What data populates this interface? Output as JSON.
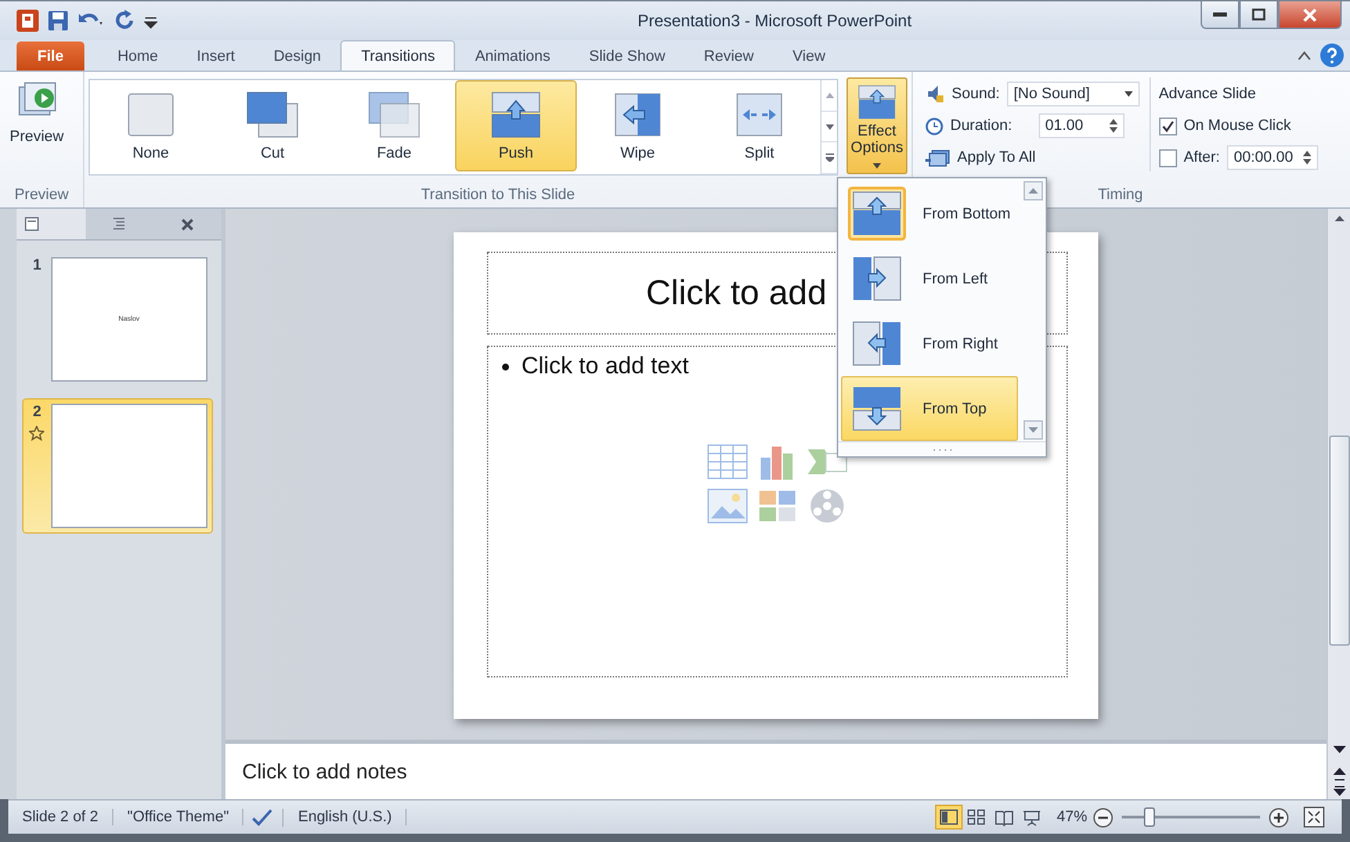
{
  "window": {
    "title": "Presentation3 - Microsoft PowerPoint"
  },
  "tabs": [
    {
      "label": "File",
      "kind": "file",
      "selected": false
    },
    {
      "label": "Home",
      "kind": "tab",
      "selected": false
    },
    {
      "label": "Insert",
      "kind": "tab",
      "selected": false
    },
    {
      "label": "Design",
      "kind": "tab",
      "selected": false
    },
    {
      "label": "Transitions",
      "kind": "tab",
      "selected": true
    },
    {
      "label": "Animations",
      "kind": "tab",
      "selected": false
    },
    {
      "label": "Slide Show",
      "kind": "tab",
      "selected": false
    },
    {
      "label": "Review",
      "kind": "tab",
      "selected": false
    },
    {
      "label": "View",
      "kind": "tab",
      "selected": false
    }
  ],
  "ribbon": {
    "preview_group": {
      "button": "Preview",
      "label": "Preview"
    },
    "transition_group": {
      "label": "Transition to This Slide",
      "effect_options": {
        "label": "Effect Options",
        "expanded": true
      },
      "items": [
        {
          "label": "None",
          "kind": "none",
          "selected": false
        },
        {
          "label": "Cut",
          "kind": "cut",
          "selected": false
        },
        {
          "label": "Fade",
          "kind": "fade",
          "selected": false
        },
        {
          "label": "Push",
          "kind": "push",
          "selected": true
        },
        {
          "label": "Wipe",
          "kind": "wipe",
          "selected": false
        },
        {
          "label": "Split",
          "kind": "split",
          "selected": false
        }
      ]
    },
    "timing_group": {
      "label": "Timing",
      "sound_label": "Sound:",
      "sound_value": "[No Sound]",
      "duration_label": "Duration:",
      "duration_value": "01.00",
      "apply_all": "Apply To All",
      "advance_title": "Advance Slide",
      "on_mouse_click": {
        "label": "On Mouse Click",
        "checked": true
      },
      "after": {
        "label": "After:",
        "checked": false,
        "value": "00:00.00"
      }
    }
  },
  "effect_menu": [
    {
      "label": "From Bottom",
      "kind": "bottom",
      "selected": true,
      "hovered": false
    },
    {
      "label": "From Left",
      "kind": "left",
      "selected": false,
      "hovered": false
    },
    {
      "label": "From Right",
      "kind": "right",
      "selected": false,
      "hovered": false
    },
    {
      "label": "From Top",
      "kind": "top",
      "selected": false,
      "hovered": true
    }
  ],
  "slides": [
    {
      "number": "1",
      "title": "Naslov",
      "selected": false,
      "has_transition": false
    },
    {
      "number": "2",
      "selected": true,
      "has_transition": true
    }
  ],
  "slide": {
    "title_placeholder": "Click to add",
    "body_placeholder": "Click to add text"
  },
  "notes": {
    "placeholder": "Click to add notes"
  },
  "status_bar": {
    "slide": "Slide 2 of 2",
    "theme": "\"Office Theme\"",
    "language": "English (U.S.)",
    "views": [
      {
        "kind": "normal",
        "selected": true
      },
      {
        "kind": "sorter",
        "selected": false
      },
      {
        "kind": "reading",
        "selected": false
      },
      {
        "kind": "show",
        "selected": false
      }
    ],
    "zoom": "47%",
    "zoom_slider": {
      "level": 0.2
    }
  }
}
